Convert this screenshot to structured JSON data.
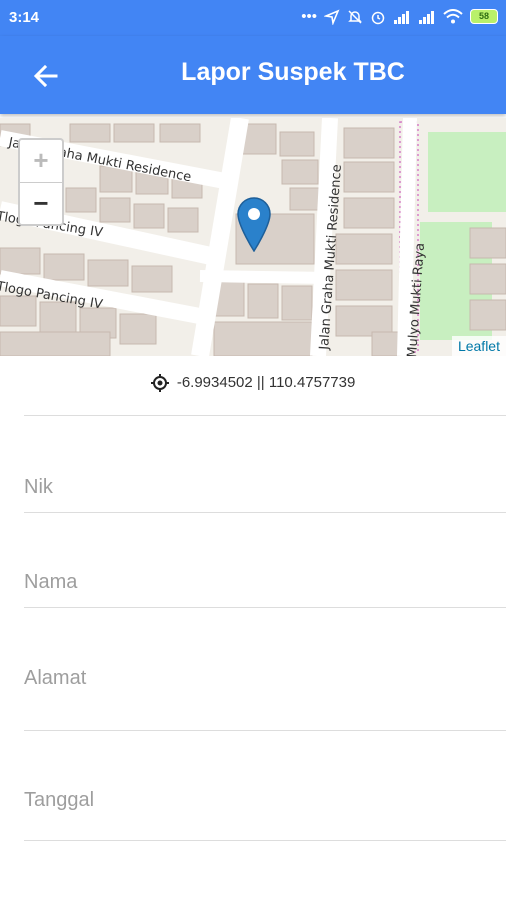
{
  "status_bar": {
    "time": "3:14",
    "battery": "58"
  },
  "app_bar": {
    "title": "Lapor Suspek TBC"
  },
  "map": {
    "streets": [
      "Jalan Graha Mukti Residence",
      "Tlogo Pancing IV",
      "Tlogo Pancing IV",
      "Jalan Graha Mukti Residence",
      "Mulyo Mukti Raya"
    ],
    "zoom_in": "+",
    "zoom_out": "−",
    "attribution": "Leaflet"
  },
  "location": {
    "coordinates": "-6.9934502 || 110.4757739"
  },
  "form": {
    "nik_placeholder": "Nik",
    "nama_placeholder": "Nama",
    "alamat_placeholder": "Alamat",
    "tanggal_placeholder": "Tanggal"
  }
}
